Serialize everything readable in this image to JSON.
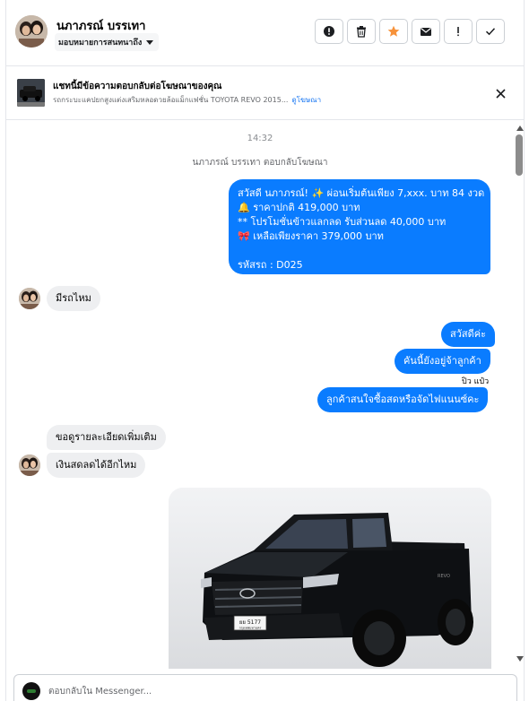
{
  "header": {
    "contact_name": "นภาภรณ์ บรรเทา",
    "assign_label": "มอบหมายการสนทนาถึง",
    "actions": [
      {
        "icon": "alert-circle-icon",
        "name": "mark-spam-button"
      },
      {
        "icon": "trash-icon",
        "name": "delete-button"
      },
      {
        "icon": "star-icon",
        "name": "star-button"
      },
      {
        "icon": "envelope-icon",
        "name": "mark-unread-button"
      },
      {
        "icon": "exclamation-icon",
        "name": "follow-up-button"
      },
      {
        "icon": "check-icon",
        "name": "done-button"
      }
    ],
    "star_color": "#f7923a"
  },
  "ad_banner": {
    "title": "แชทนี้มีข้อความตอบกลับต่อโฆษณาของคุณ",
    "subtitle": "รถกระบะแคปยกสูงแต่งเสริมหลอดวยล้อแม็กแฟชั่น TOYOTA REVO 2015...",
    "link": "ดูโฆษณา"
  },
  "thread": {
    "timestamp": "14:32",
    "replied_note": "นภาภรณ์ บรรเทา ตอบกลับโฆษณา",
    "messages": [
      {
        "from": "page",
        "lines": [
          "สวัสดี นภาภรณ์! ✨  ผ่อนเริ่มต้นเพียง 7,xxx. บาท 84 งวด",
          "🔔 ราคาปกติ 419,000 บาท",
          "** โปรโมชั่นข้าวแลกลด รับส่วนลด 40,000 บาท",
          "🎀  เหลือเพียงราคา 379,000 บาท",
          "",
          "รหัสรถ : D025"
        ]
      },
      {
        "from": "customer",
        "text": "มีรถไหม"
      },
      {
        "from": "page",
        "text": "สวัสดีค่ะ"
      },
      {
        "from": "page",
        "text": "คันนี้ยังอยู่จ้าลูกค้า"
      },
      {
        "from": "page",
        "text": "ลูกค้าสนใจซื้อสดหรือจัดไฟแนนซ์คะ"
      },
      {
        "from": "customer",
        "text": "ขอดูรายละเอียดเพิ่มเติม"
      },
      {
        "from": "customer",
        "text": "เงินสดลดได้อีกไหม"
      }
    ],
    "seen_label": "ปิว แป๋ว",
    "photo": {
      "plate_line1": "ยย 5177",
      "plate_line2": "กรุงเทพมหานคร",
      "badge_text": "REVO"
    }
  },
  "composer": {
    "placeholder": "ตอบกลับใน Messenger..."
  },
  "colors": {
    "outgoing_bubble": "#0a7cff",
    "incoming_bubble": "#eeeff1",
    "link": "#1876f2"
  }
}
